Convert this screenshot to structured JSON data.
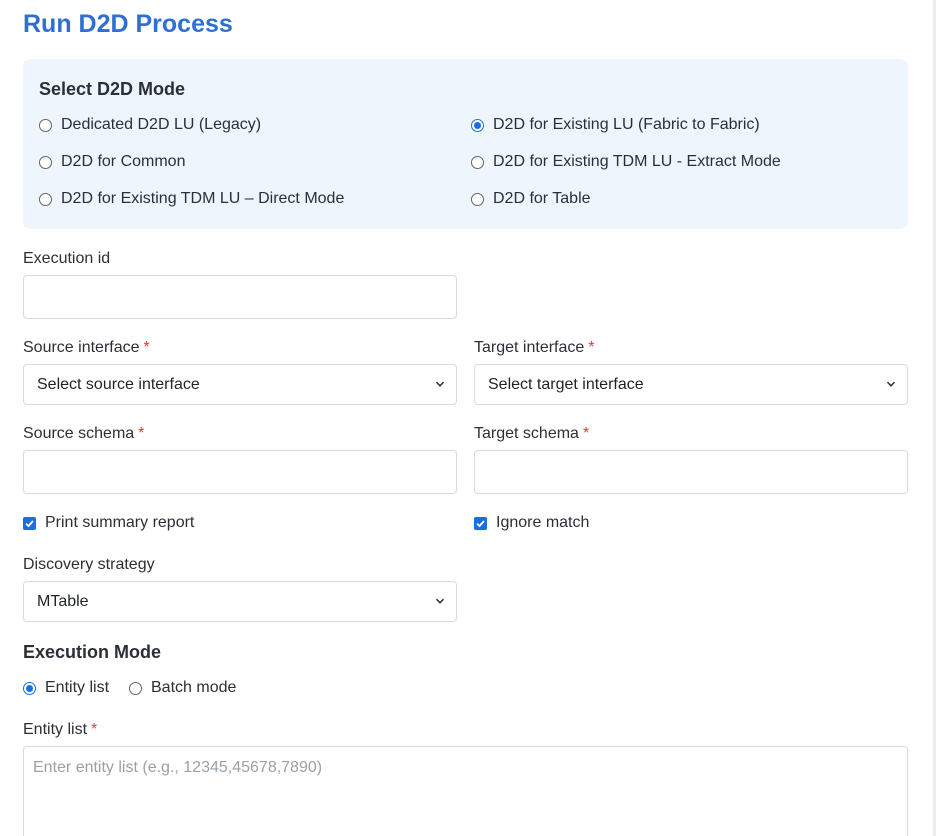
{
  "page": {
    "title": "Run D2D Process"
  },
  "mode_panel": {
    "heading": "Select D2D Mode",
    "options": [
      {
        "label": "Dedicated D2D LU (Legacy)",
        "checked": false
      },
      {
        "label": "D2D for Existing LU (Fabric to Fabric)",
        "checked": true
      },
      {
        "label": "D2D for Common",
        "checked": false
      },
      {
        "label": "D2D for Existing TDM LU - Extract Mode",
        "checked": false
      },
      {
        "label": "D2D for Existing TDM LU – Direct Mode",
        "checked": false
      },
      {
        "label": "D2D for Table",
        "checked": false
      }
    ]
  },
  "form": {
    "execution_id": {
      "label": "Execution id",
      "value": ""
    },
    "source_interface": {
      "label": "Source interface",
      "required_mark": "*",
      "value": "Select source interface"
    },
    "target_interface": {
      "label": "Target interface",
      "required_mark": "*",
      "value": "Select target interface"
    },
    "source_schema": {
      "label": "Source schema",
      "required_mark": "*",
      "value": ""
    },
    "target_schema": {
      "label": "Target schema",
      "required_mark": "*",
      "value": ""
    },
    "print_summary": {
      "label": "Print summary report",
      "checked": true
    },
    "ignore_match": {
      "label": "Ignore match",
      "checked": true
    },
    "discovery_strategy": {
      "label": "Discovery strategy",
      "value": "MTable"
    }
  },
  "execution_mode": {
    "heading": "Execution Mode",
    "options": [
      {
        "label": "Entity list",
        "checked": true
      },
      {
        "label": "Batch mode",
        "checked": false
      }
    ]
  },
  "entity_list": {
    "label": "Entity list",
    "required_mark": "*",
    "placeholder": "Enter entity list (e.g., 12345,45678,7890)",
    "value": ""
  },
  "colors": {
    "accent": "#1a6fe0",
    "title": "#2f6fd1",
    "panel_bg": "#eef5fd",
    "required": "#e53935"
  },
  "icons": {
    "select_chevron": "chevron-down-icon",
    "checkbox_mark": "check-icon"
  }
}
